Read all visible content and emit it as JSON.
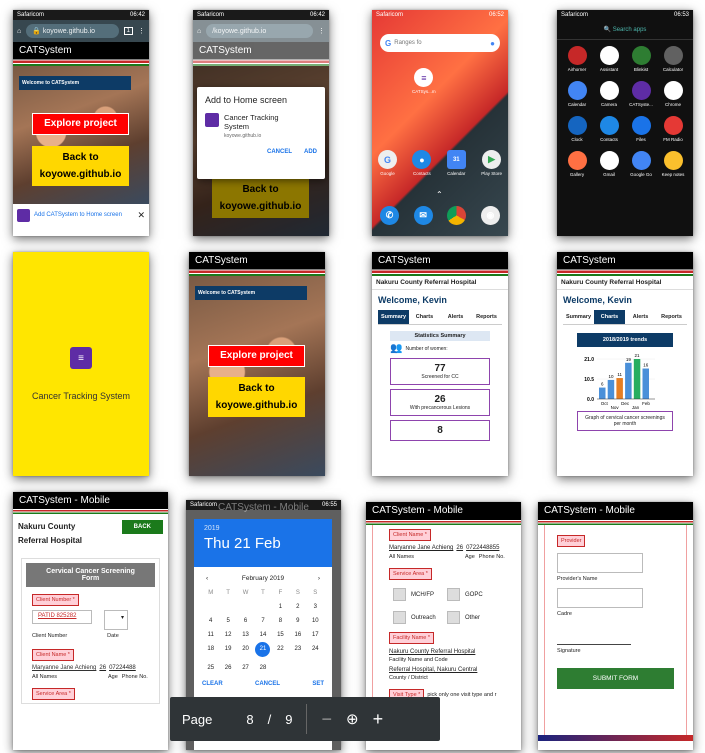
{
  "colors": {
    "accent": "#1a73e8",
    "kenya_red": "#c62828",
    "kenya_green": "#1b7a1b",
    "brand_purple": "#5e2ca5",
    "btn_yellow": "#ffd700"
  },
  "s1": {
    "carrier": "Safaricom",
    "time": "06:42",
    "url": "koyowe.github.io",
    "tabs": "1",
    "app_title": "CATSystem",
    "welcome": "Welcome to CATSystem",
    "explore": "Explore project",
    "back": "Back to koyowe.github.io",
    "banner": "Add CATSystem to Home screen"
  },
  "s2": {
    "carrier": "Safaricom",
    "time": "06:42",
    "url": "/koyowe.github.io",
    "app_title": "CATSystem",
    "dialog_title": "Add to Home screen",
    "app_name": "Cancer Tracking System",
    "domain": "koyowe.github.io",
    "cancel": "CANCEL",
    "add": "ADD",
    "back": "Back to koyowe.github.io"
  },
  "s3": {
    "carrier": "Safaricom",
    "time": "06:52",
    "search_placeholder": "Ranges fo",
    "catsys_label": "CATSys...m",
    "dock": [
      "Google",
      "Contacts",
      "Calendar",
      "Play Store"
    ]
  },
  "s4": {
    "carrier": "Safaricom",
    "time": "06:53",
    "search": "Search apps",
    "apps": [
      "Airhorner",
      "Assistant",
      "Blinkist",
      "Calculator",
      "Calendar",
      "Camera",
      "CATSyste...",
      "Chrome",
      "Clock",
      "Contacts",
      "Files",
      "FM Radio",
      "Gallery",
      "Gmail",
      "Google Go",
      "Keep notes"
    ]
  },
  "s5": {
    "title": "Cancer Tracking System"
  },
  "s6": {
    "app_title": "CATSystem",
    "welcome": "Welcome to CATSystem",
    "explore": "Explore project",
    "back": "Back to koyowe.github.io"
  },
  "s7": {
    "app_title": "CATSystem",
    "hospital": "Nakuru County Referral Hospital",
    "greeting": "Welcome, Kevin",
    "tabs": [
      "Summary",
      "Charts",
      "Alerts",
      "Reports"
    ],
    "stats_title": "Statistics Summary",
    "women_label": "Number of women:",
    "stats": [
      {
        "n": "77",
        "l": "Screened for CC"
      },
      {
        "n": "26",
        "l": "With precancerous Lesions"
      },
      {
        "n": "8",
        "l": ""
      }
    ]
  },
  "s8": {
    "app_title": "CATSystem",
    "hospital": "Nakuru County Referral Hospital",
    "greeting": "Welcome, Kevin",
    "tabs": [
      "Summary",
      "Charts",
      "Alerts",
      "Reports"
    ],
    "trend_title": "2018/2019 trends",
    "caption": "Graph of cervical cancer screenings per month"
  },
  "chart_data": {
    "type": "bar",
    "categories": [
      "Oct",
      "Nov",
      "Dec",
      "Jan",
      "Feb"
    ],
    "values": [
      6,
      10,
      11,
      19,
      21,
      16
    ],
    "ylim": [
      0,
      21
    ],
    "ytick_labels": [
      "21.0",
      "10.5",
      "0.0"
    ],
    "data_labels": [
      "6",
      "10",
      "11",
      "19",
      "21",
      "16"
    ],
    "xlabel": "",
    "ylabel": ""
  },
  "s9": {
    "app_title": "CATSystem - Mobile",
    "hospital": "Nakuru County Referral Hospital",
    "back": "BACK",
    "form_title": "Cervical Cancer Screening Form",
    "client_number_lbl": "Client Number",
    "client_number": "PATID 825282",
    "date_lbl": "Date",
    "client_name_lbl": "Client Name",
    "client_name": "Maryanne Jane Achieng",
    "age": "26",
    "phone": "07224488",
    "all_names": "All Names",
    "age_lbl": "Age",
    "phone_lbl": "Phone No.",
    "service_area_lbl": "Service Area"
  },
  "s10": {
    "carrier": "Safaricom",
    "time": "06:55",
    "behind_title": "CATSystem - Mobile",
    "year": "2019",
    "date": "Thu 21 Feb",
    "month": "February 2019",
    "dow": [
      "M",
      "T",
      "W",
      "T",
      "F",
      "S",
      "S"
    ],
    "weeks": [
      [
        "",
        "",
        "",
        "",
        "1",
        "2",
        "3"
      ],
      [
        "4",
        "5",
        "6",
        "7",
        "8",
        "9",
        "10"
      ],
      [
        "11",
        "12",
        "13",
        "14",
        "15",
        "16",
        "17"
      ],
      [
        "18",
        "19",
        "20",
        "21",
        "22",
        "23",
        "24"
      ],
      [
        "25",
        "26",
        "27",
        "28",
        "",
        "",
        ""
      ]
    ],
    "selected": "21",
    "clear": "CLEAR",
    "cancel": "CANCEL",
    "set": "SET"
  },
  "s11": {
    "app_title": "CATSystem - Mobile",
    "client_name_lbl": "Client Name",
    "client_name": "Maryanne Jane Achieng",
    "age": "26",
    "phone": "0722448855",
    "all_names": "All Names",
    "age_lbl": "Age",
    "phone_lbl": "Phone No.",
    "service_area_lbl": "Service Area",
    "areas": [
      "MCH/FP",
      "GOPC",
      "Outreach",
      "Other"
    ],
    "facility_lbl": "Facility Name",
    "facility": "Nakuru County Referral Hospital",
    "facility_code_lbl": "Facility Name and Code",
    "facility2": "Referral Hospital, Nakuru Central",
    "district_lbl": "County / District",
    "visit_lbl": "Visit Type",
    "visit_hint": "pick only one visit type and r"
  },
  "s12": {
    "app_title": "CATSystem - Mobile",
    "provider_lbl": "Provider",
    "provider_name_lbl": "Provider's Name",
    "cadre_lbl": "Cadre",
    "signature_lbl": "Signature",
    "submit": "SUBMIT FORM"
  },
  "pager": {
    "label": "Page",
    "current": "8",
    "sep": "/",
    "total": "9",
    "minus": "−",
    "plus": "+"
  }
}
